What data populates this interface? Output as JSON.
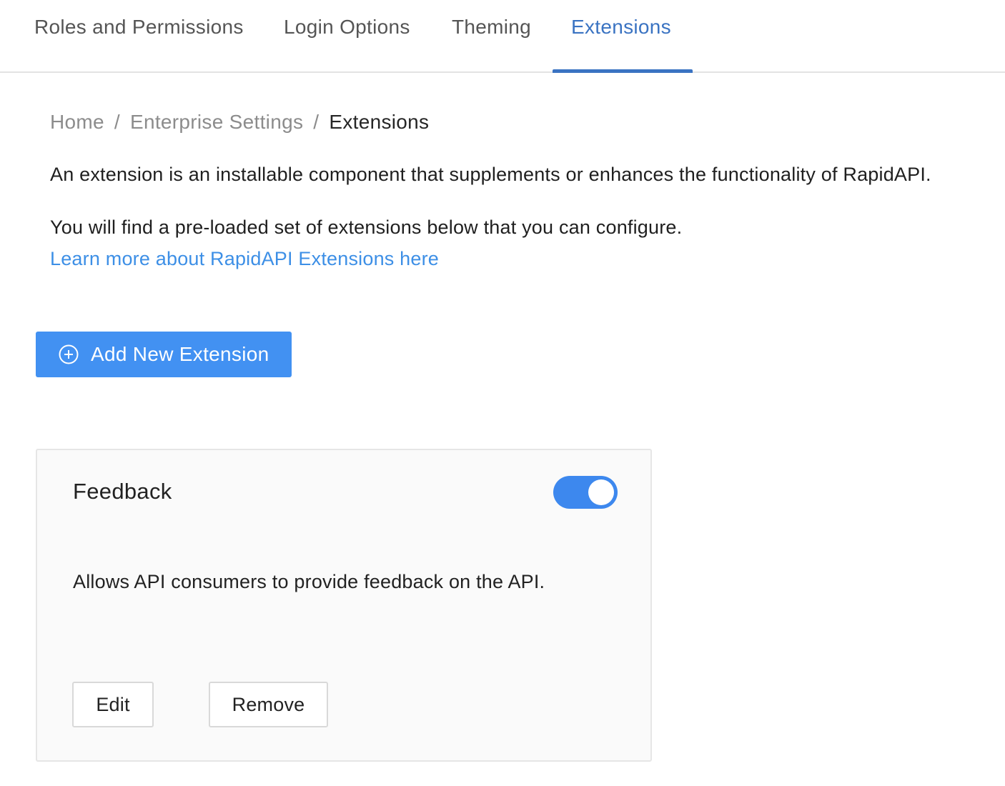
{
  "tabs": [
    {
      "label": "Roles and Permissions",
      "active": false
    },
    {
      "label": "Login Options",
      "active": false
    },
    {
      "label": "Theming",
      "active": false
    },
    {
      "label": "Extensions",
      "active": true
    }
  ],
  "breadcrumb": {
    "items": [
      "Home",
      "Enterprise Settings",
      "Extensions"
    ],
    "separator": "/"
  },
  "intro": {
    "line1": "An extension is an installable component that supplements or enhances the functionality of RapidAPI.",
    "line2": "You will find a pre-loaded set of extensions below that you can configure.",
    "link": "Learn more about RapidAPI Extensions here"
  },
  "add_button": {
    "label": "Add New Extension",
    "icon": "plus-circle-icon"
  },
  "extensions": [
    {
      "title": "Feedback",
      "enabled": true,
      "description": "Allows API consumers to provide feedback on the API.",
      "edit_label": "Edit",
      "remove_label": "Remove"
    }
  ],
  "colors": {
    "accent": "#3a73c2",
    "primary_button": "#4291f2",
    "link": "#3d8fe6",
    "toggle_on": "#3d88ee"
  }
}
